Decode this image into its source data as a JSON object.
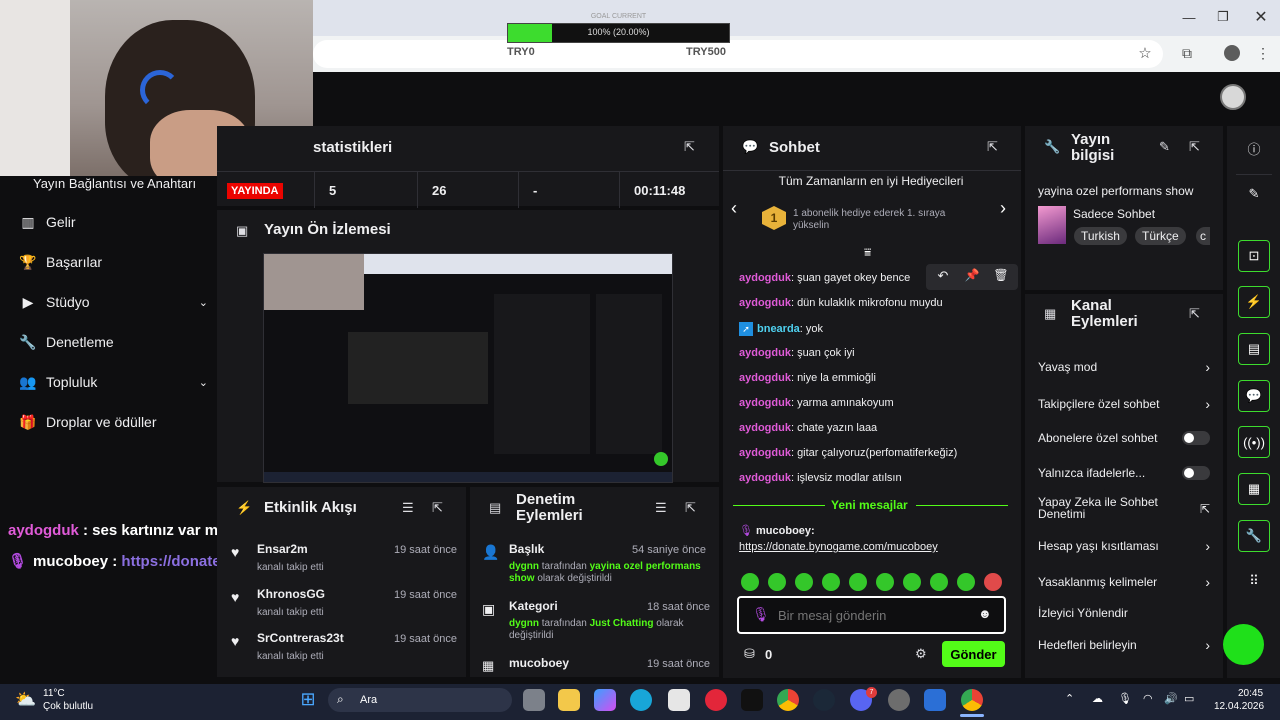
{
  "goal": {
    "title": "GOAL CURRENT",
    "progress_text": "100% (20.00%)",
    "progress": 0.2,
    "left": "TRY0",
    "right": "TRY500"
  },
  "sidebar": {
    "section_title": "Yayın Bağlantısı ve Anahtarı",
    "items": [
      {
        "label": "Gelir",
        "icon": "bar-chart-icon"
      },
      {
        "label": "Başarılar",
        "icon": "trophy-icon"
      },
      {
        "label": "Stüdyo",
        "icon": "play-icon",
        "expandable": true
      },
      {
        "label": "Denetleme",
        "icon": "wrench-icon"
      },
      {
        "label": "Topluluk",
        "icon": "people-icon",
        "expandable": true
      },
      {
        "label": "Droplar ve ödüller",
        "icon": "gift-icon"
      }
    ]
  },
  "stats": {
    "title": "statistikleri",
    "live_badge": "YAYINDA",
    "viewers": "5",
    "followers": "26",
    "dash": "-",
    "uptime": "00:11:48"
  },
  "preview": {
    "title": "Yayın Ön İzlemesi"
  },
  "overlay_chat": {
    "line1_user": "aydogduk",
    "line1_text": " : ses kartınız var mı",
    "line2_user": "mucoboey",
    "line2_text": " : ",
    "line2_link": "https://donate.bynogame.com/mucoboey"
  },
  "activity": {
    "title": "Etkinlik Akışı",
    "items": [
      {
        "name": "Ensar2m",
        "desc": "kanalı takip etti",
        "time": "19 saat önce"
      },
      {
        "name": "KhronosGG",
        "desc": "kanalı takip etti",
        "time": "19 saat önce"
      },
      {
        "name": "SrContreras23t",
        "desc": "kanalı takip etti",
        "time": "19 saat önce"
      }
    ]
  },
  "moderation": {
    "title": "Denetim Eylemleri",
    "items": [
      {
        "name": "Başlık",
        "time": "54 saniye önce",
        "actor": "dygnn",
        "mid": " tarafından ",
        "value": "yayina ozel performans show",
        "end": " olarak değiştirildi"
      },
      {
        "name": "Kategori",
        "time": "18 saat önce",
        "actor": "dygnn",
        "mid": " tarafından ",
        "value": "Just Chatting",
        "end": " olarak değiştirildi"
      },
      {
        "name": "mucoboey",
        "time": "19 saat önce"
      }
    ]
  },
  "chat": {
    "title": "Sohbet",
    "gifter_title": "Tüm Zamanların en iyi Hediyecileri",
    "gifter_rank": "1",
    "gifter_text": "1 abonelik hediye ederek 1. sıraya yükselin",
    "messages": [
      {
        "user": "aydogduk",
        "text": ": şuan gayet okey bence"
      },
      {
        "user": "aydogduk",
        "text": ": dün kulaklık mikrofonu muydu"
      },
      {
        "user": "bnearda",
        "text": ": yok",
        "badge": true
      },
      {
        "user": "aydogduk",
        "text": ": şuan çok iyi"
      },
      {
        "user": "aydogduk",
        "text": ": niye la emmioğli"
      },
      {
        "user": "aydogduk",
        "text": ": yarma amınakoyum"
      },
      {
        "user": "aydogduk",
        "text": ": chate yazın laaa"
      },
      {
        "user": "aydogduk",
        "text": ": gitar çalıyoruz(perfomatiferkeğiz)"
      },
      {
        "user": "aydogduk",
        "text": ": işlevsiz modlar atılsın"
      }
    ],
    "new_messages": "Yeni mesajlar",
    "last_user": "mucoboey:",
    "last_link": "https://donate.bynogame.com/mucoboey",
    "placeholder": "Bir mesaj gönderin",
    "points": "0",
    "send": "Gönder"
  },
  "stream_info": {
    "title": "Yayın bilgisi",
    "stream_title": "yayina ozel performans show",
    "category": "Sadece Sohbet",
    "tags": [
      "Turkish",
      "Türkçe",
      "c"
    ]
  },
  "channel_actions": {
    "title": "Kanal Eylemleri",
    "items": [
      {
        "label": "Yavaş mod",
        "type": "chevron"
      },
      {
        "label": "Takipçilere özel sohbet",
        "type": "chevron"
      },
      {
        "label": "Abonelere özel sohbet",
        "type": "toggle"
      },
      {
        "label": "Yalnızca ifadelerle...",
        "type": "toggle"
      },
      {
        "label": "Yapay Zeka ile Sohbet Denetimi",
        "type": "external"
      },
      {
        "label": "Hesap yaşı kısıtlaması",
        "type": "chevron"
      },
      {
        "label": "Yasaklanmış kelimeler",
        "type": "chevron"
      },
      {
        "label": "İzleyici Yönlendir",
        "type": "none"
      },
      {
        "label": "Hedefleri belirleyin",
        "type": "chevron"
      }
    ]
  },
  "taskbar": {
    "weather_temp": "11°C",
    "weather_desc": "Çok bulutlu",
    "search": "Ara",
    "time": "20:45",
    "date": "12.04.2026",
    "discord_badge": "7"
  },
  "colors": {
    "accent": "#53fc18",
    "panel": "#18181b",
    "bg": "#0e0e10",
    "username": "#e05bd8",
    "live": "#eb0400"
  }
}
